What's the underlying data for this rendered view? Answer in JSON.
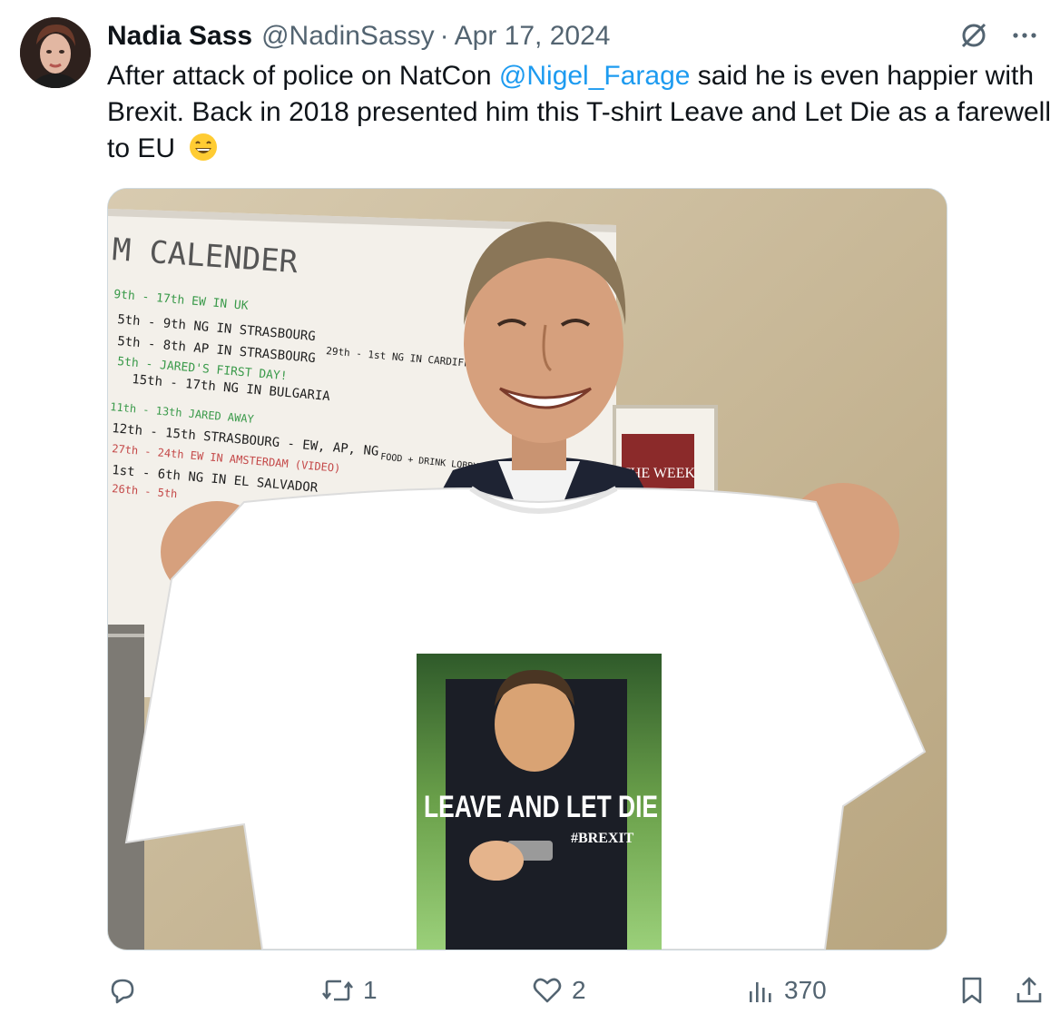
{
  "author": {
    "name": "Nadia Sass",
    "handle": "@NadinSassy",
    "separator": "·",
    "date": "Apr 17, 2024"
  },
  "tweet": {
    "text_part1": "After attack of police on NatCon ",
    "mention": "@Nigel_Farage",
    "text_part2": " said he is even happier with Brexit. Back in 2018 presented him this T-shirt Leave and Let Die as a farewell to EU",
    "emoji": "grinning-face-with-smiling-eyes"
  },
  "media": {
    "calendar_title": "M CALENDER",
    "calendar_lines": [
      "9th - 17th EW IN UK",
      "5th - 9th NG IN STRASBOURG",
      "5th - 8th AP IN STRASBOURG",
      "5th - JARED'S FIRST DAY!",
      "15th - 17th NG IN BULGARIA",
      "11th - 13th JARED AWAY",
      "12th - 15th STRASBOURG - EW, AP, NG",
      "27th - 24th EW IN AMSTERDAM (VIDEO)",
      "1st - 6th NG IN EL SALVADOR",
      "26th - 5th"
    ],
    "calendar_side": "29th - 1st NG IN CARDIFF (MINI PLENARY)",
    "calendar_side2": "FOOD + DRINK LOBBYING",
    "magazine": "THE WEEK",
    "shirt_title": "LEAVE AND LET DIE",
    "shirt_tag": "#BREXIT"
  },
  "actions": {
    "reply_count": "",
    "retweet_count": "1",
    "like_count": "2",
    "views_count": "370"
  },
  "colors": {
    "accent": "#1d9bf0",
    "muted": "#536471",
    "text": "#0f1419"
  }
}
